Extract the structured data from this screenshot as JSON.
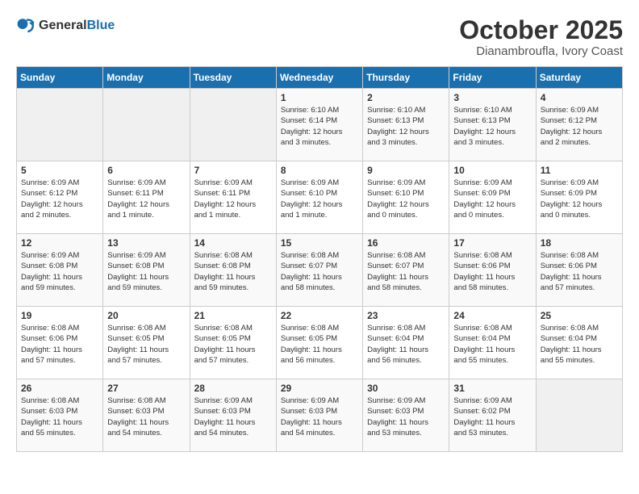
{
  "header": {
    "logo_general": "General",
    "logo_blue": "Blue",
    "month": "October 2025",
    "location": "Dianambroufla, Ivory Coast"
  },
  "weekdays": [
    "Sunday",
    "Monday",
    "Tuesday",
    "Wednesday",
    "Thursday",
    "Friday",
    "Saturday"
  ],
  "weeks": [
    [
      {
        "day": "",
        "info": ""
      },
      {
        "day": "",
        "info": ""
      },
      {
        "day": "",
        "info": ""
      },
      {
        "day": "1",
        "info": "Sunrise: 6:10 AM\nSunset: 6:14 PM\nDaylight: 12 hours\nand 3 minutes."
      },
      {
        "day": "2",
        "info": "Sunrise: 6:10 AM\nSunset: 6:13 PM\nDaylight: 12 hours\nand 3 minutes."
      },
      {
        "day": "3",
        "info": "Sunrise: 6:10 AM\nSunset: 6:13 PM\nDaylight: 12 hours\nand 3 minutes."
      },
      {
        "day": "4",
        "info": "Sunrise: 6:09 AM\nSunset: 6:12 PM\nDaylight: 12 hours\nand 2 minutes."
      }
    ],
    [
      {
        "day": "5",
        "info": "Sunrise: 6:09 AM\nSunset: 6:12 PM\nDaylight: 12 hours\nand 2 minutes."
      },
      {
        "day": "6",
        "info": "Sunrise: 6:09 AM\nSunset: 6:11 PM\nDaylight: 12 hours\nand 1 minute."
      },
      {
        "day": "7",
        "info": "Sunrise: 6:09 AM\nSunset: 6:11 PM\nDaylight: 12 hours\nand 1 minute."
      },
      {
        "day": "8",
        "info": "Sunrise: 6:09 AM\nSunset: 6:10 PM\nDaylight: 12 hours\nand 1 minute."
      },
      {
        "day": "9",
        "info": "Sunrise: 6:09 AM\nSunset: 6:10 PM\nDaylight: 12 hours\nand 0 minutes."
      },
      {
        "day": "10",
        "info": "Sunrise: 6:09 AM\nSunset: 6:09 PM\nDaylight: 12 hours\nand 0 minutes."
      },
      {
        "day": "11",
        "info": "Sunrise: 6:09 AM\nSunset: 6:09 PM\nDaylight: 12 hours\nand 0 minutes."
      }
    ],
    [
      {
        "day": "12",
        "info": "Sunrise: 6:09 AM\nSunset: 6:08 PM\nDaylight: 11 hours\nand 59 minutes."
      },
      {
        "day": "13",
        "info": "Sunrise: 6:09 AM\nSunset: 6:08 PM\nDaylight: 11 hours\nand 59 minutes."
      },
      {
        "day": "14",
        "info": "Sunrise: 6:08 AM\nSunset: 6:08 PM\nDaylight: 11 hours\nand 59 minutes."
      },
      {
        "day": "15",
        "info": "Sunrise: 6:08 AM\nSunset: 6:07 PM\nDaylight: 11 hours\nand 58 minutes."
      },
      {
        "day": "16",
        "info": "Sunrise: 6:08 AM\nSunset: 6:07 PM\nDaylight: 11 hours\nand 58 minutes."
      },
      {
        "day": "17",
        "info": "Sunrise: 6:08 AM\nSunset: 6:06 PM\nDaylight: 11 hours\nand 58 minutes."
      },
      {
        "day": "18",
        "info": "Sunrise: 6:08 AM\nSunset: 6:06 PM\nDaylight: 11 hours\nand 57 minutes."
      }
    ],
    [
      {
        "day": "19",
        "info": "Sunrise: 6:08 AM\nSunset: 6:06 PM\nDaylight: 11 hours\nand 57 minutes."
      },
      {
        "day": "20",
        "info": "Sunrise: 6:08 AM\nSunset: 6:05 PM\nDaylight: 11 hours\nand 57 minutes."
      },
      {
        "day": "21",
        "info": "Sunrise: 6:08 AM\nSunset: 6:05 PM\nDaylight: 11 hours\nand 57 minutes."
      },
      {
        "day": "22",
        "info": "Sunrise: 6:08 AM\nSunset: 6:05 PM\nDaylight: 11 hours\nand 56 minutes."
      },
      {
        "day": "23",
        "info": "Sunrise: 6:08 AM\nSunset: 6:04 PM\nDaylight: 11 hours\nand 56 minutes."
      },
      {
        "day": "24",
        "info": "Sunrise: 6:08 AM\nSunset: 6:04 PM\nDaylight: 11 hours\nand 55 minutes."
      },
      {
        "day": "25",
        "info": "Sunrise: 6:08 AM\nSunset: 6:04 PM\nDaylight: 11 hours\nand 55 minutes."
      }
    ],
    [
      {
        "day": "26",
        "info": "Sunrise: 6:08 AM\nSunset: 6:03 PM\nDaylight: 11 hours\nand 55 minutes."
      },
      {
        "day": "27",
        "info": "Sunrise: 6:08 AM\nSunset: 6:03 PM\nDaylight: 11 hours\nand 54 minutes."
      },
      {
        "day": "28",
        "info": "Sunrise: 6:09 AM\nSunset: 6:03 PM\nDaylight: 11 hours\nand 54 minutes."
      },
      {
        "day": "29",
        "info": "Sunrise: 6:09 AM\nSunset: 6:03 PM\nDaylight: 11 hours\nand 54 minutes."
      },
      {
        "day": "30",
        "info": "Sunrise: 6:09 AM\nSunset: 6:03 PM\nDaylight: 11 hours\nand 53 minutes."
      },
      {
        "day": "31",
        "info": "Sunrise: 6:09 AM\nSunset: 6:02 PM\nDaylight: 11 hours\nand 53 minutes."
      },
      {
        "day": "",
        "info": ""
      }
    ]
  ]
}
